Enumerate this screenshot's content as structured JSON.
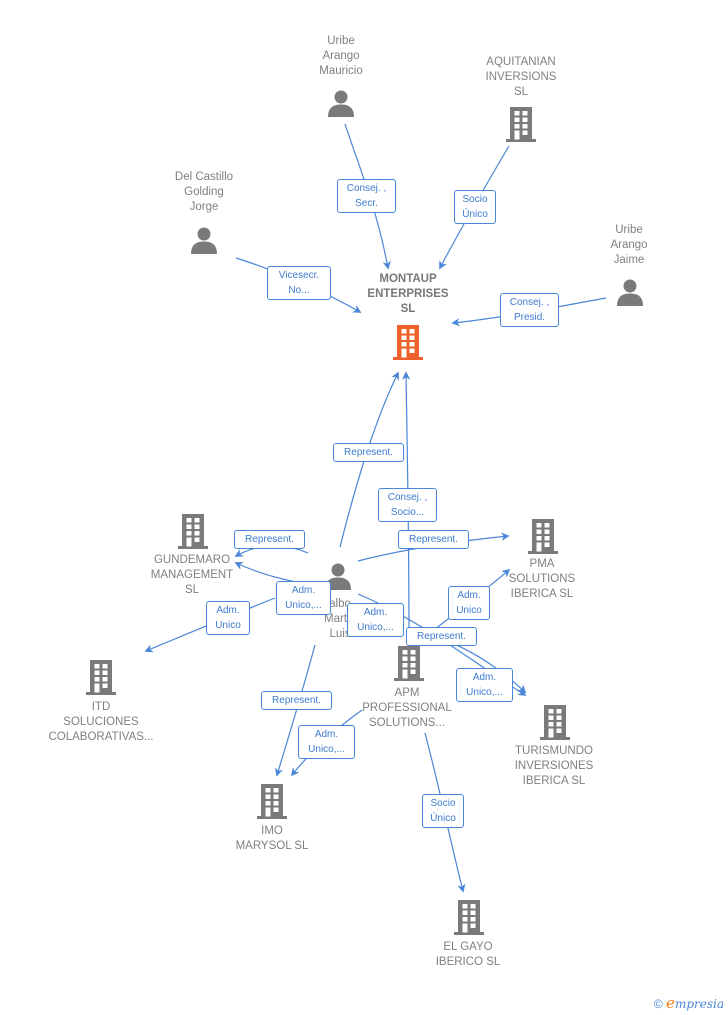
{
  "colors": {
    "edge": "#4a86d8",
    "node_icon": "#7a7a7a",
    "main_icon": "#f0602a",
    "label_text": "#808080"
  },
  "nodes": [
    {
      "id": "montaup",
      "type": "company",
      "main": true,
      "label": "MONTAUP\nENTERPRISES\nSL"
    },
    {
      "id": "uribe_mauricio",
      "type": "person",
      "label": "Uribe\nArango\nMauricio"
    },
    {
      "id": "aquitanian",
      "type": "company",
      "label": "AQUITANIAN\nINVERSIONS\nSL"
    },
    {
      "id": "del_castillo",
      "type": "person",
      "label": "Del Castillo\nGolding\nJorge"
    },
    {
      "id": "uribe_jaime",
      "type": "person",
      "label": "Uribe\nArango\nJaime"
    },
    {
      "id": "gundemaro",
      "type": "company",
      "label": "GUNDEMARO\nMANAGEMENT\nSL"
    },
    {
      "id": "pma",
      "type": "company",
      "label": "PMA\nSOLUTIONS\nIBERICA  SL"
    },
    {
      "id": "central_person",
      "type": "person",
      "label": "albo\nMartin\nLuis"
    },
    {
      "id": "itd",
      "type": "company",
      "label": "ITD\nSOLUCIONES\nCOLABORATIVAS..."
    },
    {
      "id": "apm",
      "type": "company",
      "label": "APM\nPROFESSIONAL\nSOLUTIONS..."
    },
    {
      "id": "turismundo",
      "type": "company",
      "label": "TURISMUNDO\nINVERSIONES\nIBERICA  SL"
    },
    {
      "id": "imo",
      "type": "company",
      "label": "IMO\nMARYSOL  SL"
    },
    {
      "id": "el_gayo",
      "type": "company",
      "label": "EL GAYO\nIBERICO  SL"
    }
  ],
  "edges": [
    {
      "from": "uribe_mauricio",
      "to": "montaup",
      "label": "Consej. ,\nSecr."
    },
    {
      "from": "aquitanian",
      "to": "montaup",
      "label": "Socio\nÚnico"
    },
    {
      "from": "del_castillo",
      "to": "montaup",
      "label": "Vicesecr.\nNo..."
    },
    {
      "from": "uribe_jaime",
      "to": "montaup",
      "label": "Consej. ,\nPresid."
    },
    {
      "from": "central_person",
      "to": "montaup",
      "label": "Represent."
    },
    {
      "from": "apm",
      "to": "montaup",
      "label": "Consej. ,\nSocio..."
    },
    {
      "from": "central_person",
      "to": "gundemaro",
      "label": "Represent."
    },
    {
      "from": "central_person",
      "to": "pma",
      "label": "Represent."
    },
    {
      "from": "central_person",
      "to": "gundemaro",
      "label": "Adm.\nUnico,..."
    },
    {
      "from": "gundemaro",
      "to": "itd",
      "label": "Adm.\nUnico"
    },
    {
      "from": "central_person",
      "to": "turismundo",
      "label": "Adm.\nUnico,..."
    },
    {
      "from": "apm",
      "to": "pma",
      "label": "Adm.\nUnico"
    },
    {
      "from": "apm",
      "to": "turismundo",
      "label": "Represent."
    },
    {
      "from": "apm",
      "to": "turismundo",
      "label": "Adm.\nUnico,..."
    },
    {
      "from": "central_person",
      "to": "imo",
      "label": "Represent."
    },
    {
      "from": "apm",
      "to": "imo",
      "label": "Adm.\nUnico,..."
    },
    {
      "from": "apm",
      "to": "el_gayo",
      "label": "Socio\nÚnico"
    }
  ],
  "footer": {
    "copyright": "©",
    "brand_first": "e",
    "brand_rest": "mpresia"
  }
}
